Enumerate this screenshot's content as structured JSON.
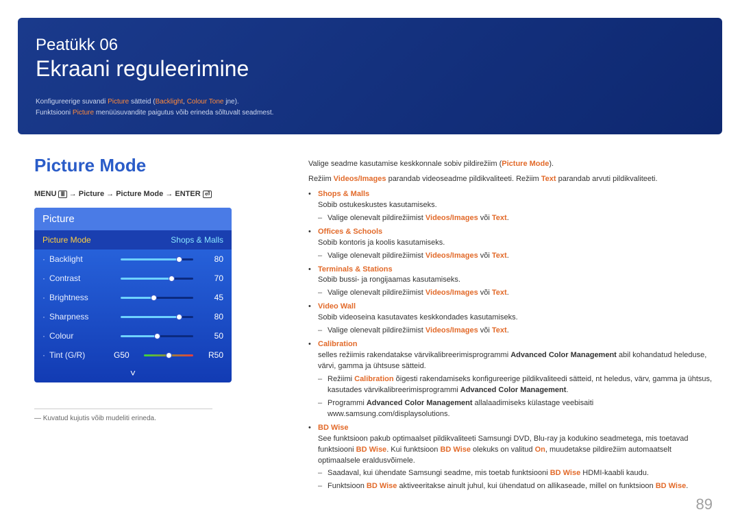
{
  "hero": {
    "chapter": "Peatükk 06",
    "heading": "Ekraani reguleerimine",
    "line1_a": "Konfigureerige suvandi ",
    "line1_hl1": "Picture",
    "line1_b": " sätteid (",
    "line1_hl2": "Backlight",
    "line1_c": ", ",
    "line1_hl3": "Colour Tone",
    "line1_d": " jne).",
    "line2_a": "Funktsiooni ",
    "line2_hl": "Picture",
    "line2_b": " menüüsuvandite paigutus võib erineda sõltuvalt seadmest."
  },
  "left": {
    "title": "Picture Mode",
    "menu_path": {
      "menu": "MENU",
      "a": " → Picture → Picture Mode → ",
      "enter": "ENTER"
    },
    "footnote": "Kuvatud kujutis võib mudeliti erineda."
  },
  "osd": {
    "head": "Picture",
    "mode_label": "Picture Mode",
    "mode_value": "Shops & Malls",
    "rows": [
      {
        "label": "Backlight",
        "value": 80
      },
      {
        "label": "Contrast",
        "value": 70
      },
      {
        "label": "Brightness",
        "value": 45
      },
      {
        "label": "Sharpness",
        "value": 80
      },
      {
        "label": "Colour",
        "value": 50
      }
    ],
    "tint": {
      "label": "Tint (G/R)",
      "g": "G50",
      "r": "R50"
    },
    "chevron": "˅"
  },
  "right": {
    "intro_a": "Valige seadme kasutamise keskkonnale sobiv pildirežiim (",
    "intro_hl": "Picture Mode",
    "intro_b": ").",
    "line2_a": "Režiim ",
    "line2_hl1": "Videos/Images",
    "line2_b": " parandab videoseadme pildikvaliteeti. Režiim ",
    "line2_hl2": "Text",
    "line2_c": " parandab arvuti pildikvaliteeti.",
    "common_sub_a": "Valige olenevalt pildirežiimist ",
    "common_sub_hl1": "Videos/Images",
    "common_sub_mid": " või ",
    "common_sub_hl2": "Text",
    "common_sub_end": ".",
    "opts": {
      "shops": {
        "name": "Shops & Malls",
        "desc": "Sobib ostukeskustes kasutamiseks."
      },
      "offices": {
        "name": "Offices & Schools",
        "desc": "Sobib kontoris ja koolis kasutamiseks."
      },
      "terminals": {
        "name": "Terminals & Stations",
        "desc": "Sobib bussi- ja rongijaamas kasutamiseks."
      },
      "videowall": {
        "name": "Video Wall",
        "desc": "Sobib videoseina kasutavates keskkondades kasutamiseks."
      },
      "calibration": {
        "name": "Calibration",
        "desc_a": "selles režiimis rakendatakse värvikalibreerimisprogrammi ",
        "desc_b": "Advanced Color Management",
        "desc_c": " abil kohandatud heleduse, värvi, gamma ja ühtsuse sätteid.",
        "sub1_a": "Režiimi ",
        "sub1_hl": "Calibration",
        "sub1_b": " õigesti rakendamiseks konfigureerige pildikvaliteedi sätteid, nt heledus, värv, gamma ja ühtsus, kasutades värvikalibreerimisprogrammi ",
        "sub1_bold": "Advanced Color Management",
        "sub1_end": ".",
        "sub2_a": "Programmi ",
        "sub2_bold": "Advanced Color Management",
        "sub2_b": " allalaadimiseks külastage veebisaiti www.samsung.com/displaysolutions."
      },
      "bdwise": {
        "name": "BD Wise",
        "desc_a": "See funktsioon pakub optimaalset pildikvaliteeti Samsungi DVD, Blu-ray ja kodukino seadmetega, mis toetavad funktsiooni ",
        "desc_hl1": "BD Wise",
        "desc_b": ". Kui funktsioon ",
        "desc_hl2": "BD Wise",
        "desc_c": " olekuks on valitud ",
        "desc_hl3": "On",
        "desc_d": ", muudetakse pildirežiim automaatselt optimaalsele eraldusvõimele.",
        "sub1_a": "Saadaval, kui ühendate Samsungi seadme, mis toetab funktsiooni ",
        "sub1_hl": "BD Wise",
        "sub1_b": " HDMI-kaabli kaudu.",
        "sub2_a": "Funktsioon ",
        "sub2_hl1": "BD Wise",
        "sub2_b": " aktiveeritakse ainult juhul, kui ühendatud on allikaseade, millel on funktsioon ",
        "sub2_hl2": "BD Wise",
        "sub2_end": "."
      }
    }
  },
  "page_num": "89"
}
